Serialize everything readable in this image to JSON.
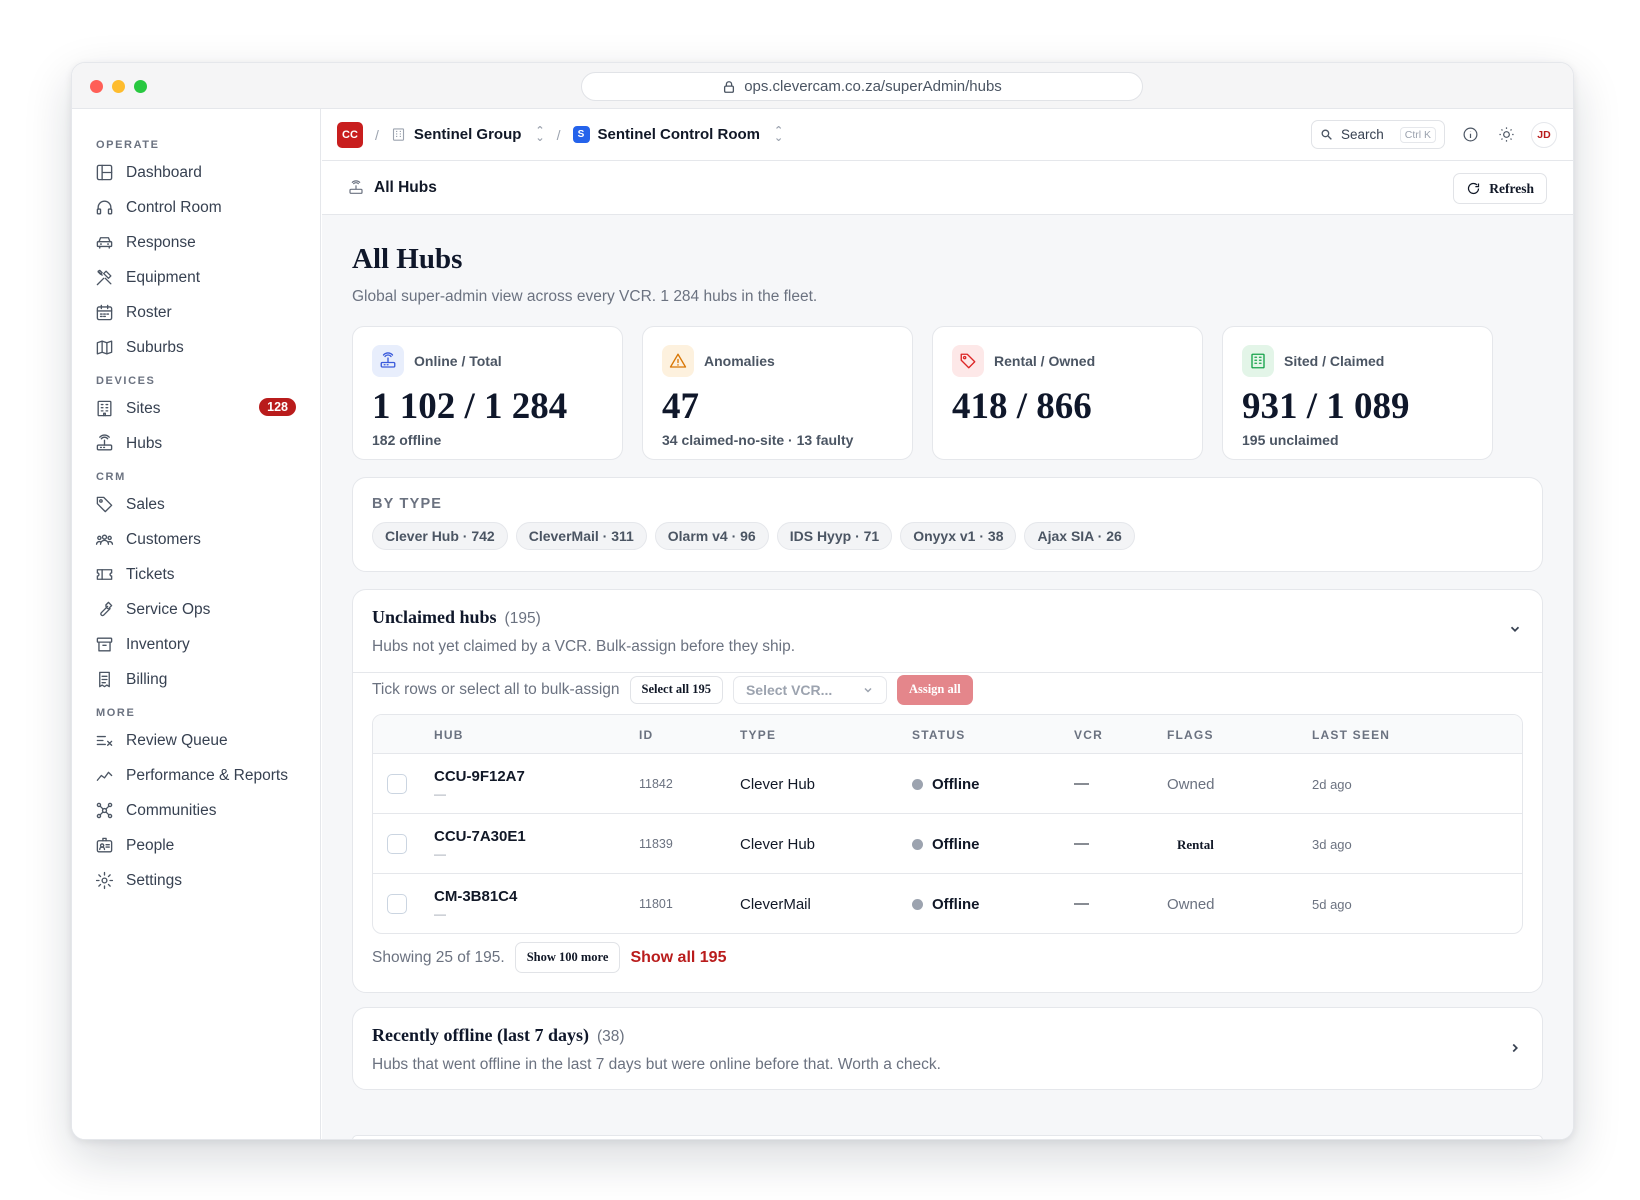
{
  "browser": {
    "url": "ops.clevercam.co.za/superAdmin/hubs"
  },
  "sidebar": {
    "sections": [
      {
        "label": "OPERATE",
        "items": [
          {
            "label": "Dashboard",
            "icon": "dashboard-icon"
          },
          {
            "label": "Control Room",
            "icon": "headset-icon"
          },
          {
            "label": "Response",
            "icon": "car-icon"
          },
          {
            "label": "Equipment",
            "icon": "tools-icon"
          },
          {
            "label": "Roster",
            "icon": "calendar-icon"
          },
          {
            "label": "Suburbs",
            "icon": "map-icon"
          }
        ]
      },
      {
        "label": "DEVICES",
        "items": [
          {
            "label": "Sites",
            "icon": "building-icon",
            "badge": "128"
          },
          {
            "label": "Hubs",
            "icon": "router-icon"
          }
        ]
      },
      {
        "label": "CRM",
        "items": [
          {
            "label": "Sales",
            "icon": "tag-icon"
          },
          {
            "label": "Customers",
            "icon": "users-icon"
          },
          {
            "label": "Tickets",
            "icon": "ticket-icon"
          },
          {
            "label": "Service Ops",
            "icon": "wrench-icon"
          },
          {
            "label": "Inventory",
            "icon": "archive-icon"
          },
          {
            "label": "Billing",
            "icon": "receipt-icon"
          }
        ]
      },
      {
        "label": "MORE",
        "items": [
          {
            "label": "Review Queue",
            "icon": "review-list-icon"
          },
          {
            "label": "Performance & Reports",
            "icon": "chart-line-icon"
          },
          {
            "label": "Communities",
            "icon": "network-icon"
          },
          {
            "label": "People",
            "icon": "id-card-icon"
          },
          {
            "label": "Settings",
            "icon": "gear-icon"
          }
        ]
      }
    ]
  },
  "topbar": {
    "org_logo": "CC",
    "group": "Sentinel Group",
    "room_logo": "S",
    "room": "Sentinel Control Room",
    "search_label": "Search",
    "search_shortcut": "Ctrl K",
    "avatar": "JD"
  },
  "subbar": {
    "title": "All Hubs",
    "refresh_label": "Refresh"
  },
  "page": {
    "title": "All Hubs",
    "subtitle": "Global super-admin view across every VCR. 1 284 hubs in the fleet."
  },
  "kpis": [
    {
      "label": "Online / Total",
      "value": "1 102 / 1 284",
      "sub": "182 offline",
      "icon": "router-icon",
      "color": "#3b5bdb",
      "bg": "#e8eefc"
    },
    {
      "label": "Anomalies",
      "value": "47",
      "sub": "34 claimed-no-site · 13 faulty",
      "icon": "warning-icon",
      "color": "#d97706",
      "bg": "#fdf1de"
    },
    {
      "label": "Rental / Owned",
      "value": "418 / 866",
      "sub": "",
      "icon": "tag-icon",
      "color": "#dc2626",
      "bg": "#fde8e8"
    },
    {
      "label": "Sited / Claimed",
      "value": "931 / 1 089",
      "sub": "195 unclaimed",
      "icon": "building-icon",
      "color": "#16a34a",
      "bg": "#e3f5e8"
    }
  ],
  "by_type": {
    "label": "BY TYPE",
    "chips": [
      "Clever Hub · 742",
      "CleverMail · 311",
      "Olarm v4 · 96",
      "IDS Hyyp · 71",
      "Onyyx v1 · 38",
      "Ajax SIA · 26"
    ]
  },
  "unclaimed": {
    "title": "Unclaimed hubs",
    "count": "(195)",
    "subtitle": "Hubs not yet claimed by a VCR. Bulk-assign before they ship.",
    "bulk_label": "Tick rows or select all to bulk-assign",
    "select_all_label": "Select all 195",
    "select_vcr_placeholder": "Select VCR...",
    "assign_all_label": "Assign all",
    "columns": [
      "HUB",
      "ID",
      "TYPE",
      "STATUS",
      "VCR",
      "FLAGS",
      "LAST SEEN"
    ],
    "rows": [
      {
        "hub": "CCU-9F12A7",
        "sub": "—",
        "id": "11842",
        "type": "Clever Hub",
        "status": "Offline",
        "vcr": "—",
        "flags": "Owned",
        "last_seen": "2d ago"
      },
      {
        "hub": "CCU-7A30E1",
        "sub": "—",
        "id": "11839",
        "type": "Clever Hub",
        "status": "Offline",
        "vcr": "—",
        "flags": "Rental",
        "last_seen": "3d ago"
      },
      {
        "hub": "CM-3B81C4",
        "sub": "—",
        "id": "11801",
        "type": "CleverMail",
        "status": "Offline",
        "vcr": "—",
        "flags": "Owned",
        "last_seen": "5d ago"
      }
    ],
    "showing_label": "Showing 25 of 195.",
    "show_more_label": "Show 100 more",
    "show_all_label": "Show all 195"
  },
  "recent": {
    "title": "Recently offline (last 7 days)",
    "count": "(38)",
    "subtitle": "Hubs that went offline in the last 7 days but were online before that. Worth a check."
  }
}
